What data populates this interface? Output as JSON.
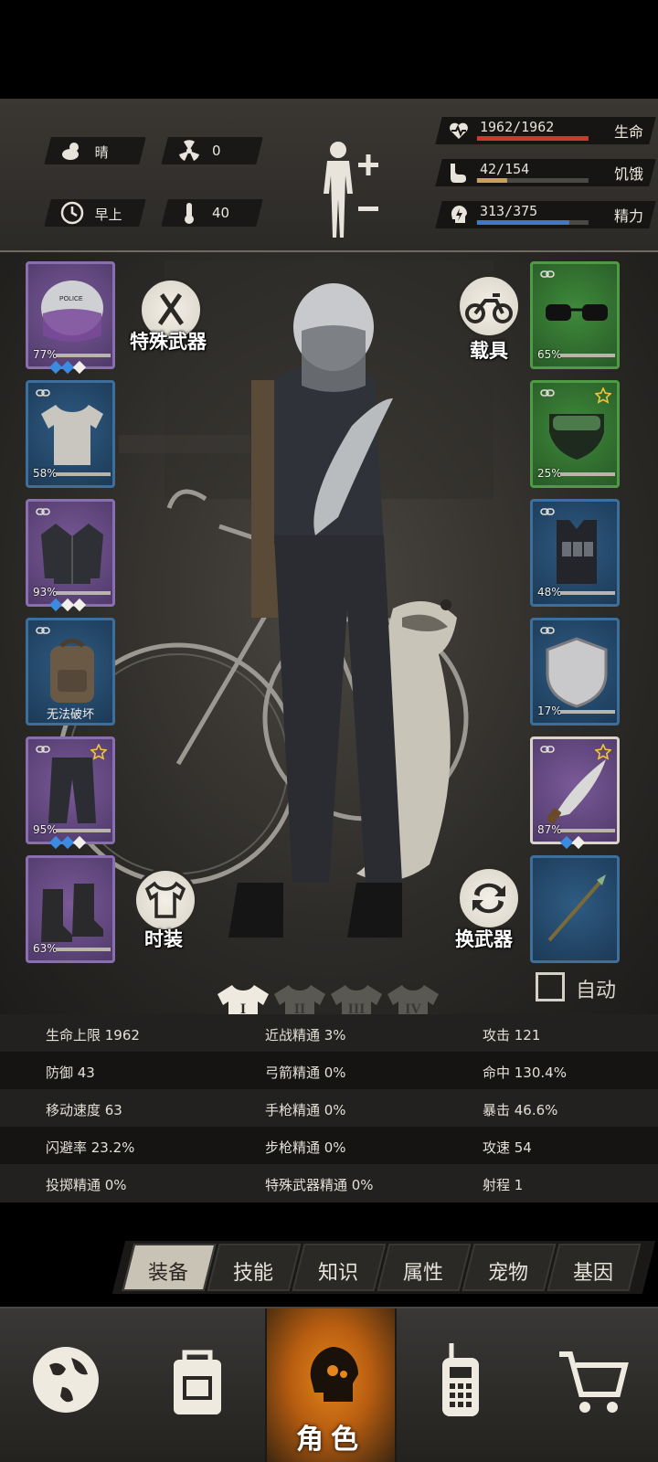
{
  "status": {
    "weather": {
      "icon": "cloud-sun-icon",
      "label": "晴"
    },
    "radiation": {
      "icon": "radiation-icon",
      "value": "0"
    },
    "time_of_day": {
      "icon": "clock-icon",
      "label": "早上"
    },
    "temperature": {
      "icon": "thermometer-icon",
      "value": "40"
    },
    "vitals": [
      {
        "key": "health",
        "icon": "heart-pulse-icon",
        "value": "1962/1962",
        "label": "生命",
        "fill": 1.0,
        "color": "#c63d2f"
      },
      {
        "key": "hunger",
        "icon": "stomach-icon",
        "value": "42/154",
        "label": "饥饿",
        "fill": 0.27,
        "color": "#c9a15a"
      },
      {
        "key": "energy",
        "icon": "energy-head-icon",
        "value": "313/375",
        "label": "精力",
        "fill": 0.83,
        "color": "#3f78c4"
      }
    ]
  },
  "left_slots": [
    {
      "name": "helmet-slot",
      "icon": "police-helmet-icon",
      "rarity": "purple",
      "pct": "77%",
      "durability": 0.77,
      "gems": [
        "blue",
        "blue",
        "white"
      ],
      "link": false,
      "star": false
    },
    {
      "name": "shirt-slot",
      "icon": "shirt-icon",
      "rarity": "blue",
      "pct": "58%",
      "durability": 0.58,
      "gems": [],
      "link": true,
      "star": false
    },
    {
      "name": "jacket-slot",
      "icon": "jacket-icon",
      "rarity": "purple",
      "pct": "93%",
      "durability": 0.93,
      "gems": [
        "blue",
        "white",
        "white"
      ],
      "link": true,
      "star": false
    },
    {
      "name": "backpack-slot",
      "icon": "backpack-icon",
      "rarity": "blue",
      "text": "无法破坏",
      "gems": [],
      "link": true,
      "star": false
    },
    {
      "name": "pants-slot",
      "icon": "pants-icon",
      "rarity": "purple",
      "pct": "95%",
      "durability": 0.95,
      "gems": [
        "blue",
        "blue",
        "white"
      ],
      "link": true,
      "star": true
    },
    {
      "name": "boots-slot",
      "icon": "boots-icon",
      "rarity": "purple",
      "pct": "63%",
      "durability": 0.63,
      "gems": [],
      "link": false,
      "star": false
    }
  ],
  "right_slots": [
    {
      "name": "glasses-slot",
      "icon": "glasses-icon",
      "rarity": "green",
      "pct": "65%",
      "durability": 0.65,
      "gems": [],
      "link": true,
      "star": false
    },
    {
      "name": "mask-slot",
      "icon": "gas-mask-icon",
      "rarity": "green",
      "pct": "25%",
      "durability": 0.25,
      "gems": [],
      "link": true,
      "star": true
    },
    {
      "name": "vest-slot",
      "icon": "tactical-vest-icon",
      "rarity": "blue",
      "pct": "48%",
      "durability": 0.48,
      "gems": [],
      "link": true,
      "star": false
    },
    {
      "name": "shield-slot",
      "icon": "shield-icon",
      "rarity": "blue",
      "pct": "17%",
      "durability": 0.17,
      "gems": [],
      "link": true,
      "star": false
    },
    {
      "name": "machete-slot",
      "icon": "machete-icon",
      "rarity": "purple",
      "pct": "87%",
      "durability": 0.87,
      "gems": [
        "blue",
        "white"
      ],
      "link": true,
      "star": true,
      "selected": true
    },
    {
      "name": "spear-slot",
      "icon": "spear-icon",
      "rarity": "blue",
      "gems": [],
      "link": false,
      "star": false
    }
  ],
  "buttons": {
    "special_weapon": "特殊武器",
    "vehicle": "载具",
    "fashion": "时装",
    "swap_weapon": "换武器",
    "auto": "自动"
  },
  "outfit_tabs": [
    "I",
    "II",
    "III",
    "IV"
  ],
  "stats": [
    [
      "生命上限 1962",
      "近战精通 3%",
      "攻击 121"
    ],
    [
      "防御 43",
      "弓箭精通 0%",
      "命中 130.4%"
    ],
    [
      "移动速度 63",
      "手枪精通 0%",
      "暴击 46.6%"
    ],
    [
      "闪避率 23.2%",
      "步枪精通 0%",
      "攻速 54"
    ],
    [
      "投掷精通 0%",
      "特殊武器精通 0%",
      "射程 1"
    ]
  ],
  "menu_tabs": [
    "装备",
    "技能",
    "知识",
    "属性",
    "宠物",
    "基因"
  ],
  "bottom_nav": [
    {
      "icon": "globe-icon",
      "label": ""
    },
    {
      "icon": "backpack-icon",
      "label": ""
    },
    {
      "icon": "character-head-icon",
      "label": "角色"
    },
    {
      "icon": "radio-icon",
      "label": ""
    },
    {
      "icon": "cart-icon",
      "label": ""
    }
  ]
}
